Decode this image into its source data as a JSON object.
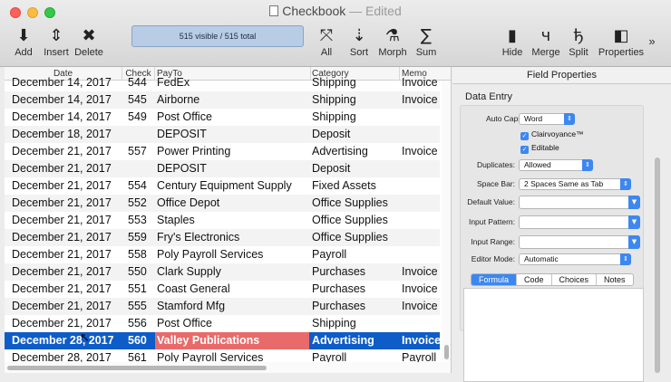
{
  "window": {
    "title": "Checkbook",
    "edited": "— Edited"
  },
  "toolbar": {
    "add": "Add",
    "insert": "Insert",
    "delete": "Delete",
    "status": "515 visible / 515 total",
    "all": "All",
    "sort": "Sort",
    "morph": "Morph",
    "sum": "Sum",
    "hide": "Hide",
    "merge": "Merge",
    "split": "Split",
    "properties": "Properties",
    "overflow": "»"
  },
  "table": {
    "columns": [
      "Date",
      "Check",
      "PayTo",
      "Category",
      "Memo"
    ],
    "rows": [
      [
        "December 14, 2017",
        "544",
        "FedEx",
        "Shipping",
        "Invoice"
      ],
      [
        "December 14, 2017",
        "545",
        "Airborne",
        "Shipping",
        "Invoice"
      ],
      [
        "December 14, 2017",
        "549",
        "Post Office",
        "Shipping",
        ""
      ],
      [
        "December 18, 2017",
        "",
        "DEPOSIT",
        "Deposit",
        ""
      ],
      [
        "December 21, 2017",
        "557",
        "Power Printing",
        "Advertising",
        "Invoice"
      ],
      [
        "December 21, 2017",
        "",
        "DEPOSIT",
        "Deposit",
        ""
      ],
      [
        "December 21, 2017",
        "554",
        "Century Equipment Supply",
        "Fixed Assets",
        ""
      ],
      [
        "December 21, 2017",
        "552",
        "Office Depot",
        "Office Supplies",
        ""
      ],
      [
        "December 21, 2017",
        "553",
        "Staples",
        "Office Supplies",
        ""
      ],
      [
        "December 21, 2017",
        "559",
        "Fry's Electronics",
        "Office Supplies",
        ""
      ],
      [
        "December 21, 2017",
        "558",
        "Poly Payroll Services",
        "Payroll",
        ""
      ],
      [
        "December 21, 2017",
        "550",
        "Clark Supply",
        "Purchases",
        "Invoice"
      ],
      [
        "December 21, 2017",
        "551",
        "Coast General",
        "Purchases",
        "Invoice"
      ],
      [
        "December 21, 2017",
        "555",
        "Stamford Mfg",
        "Purchases",
        "Invoice"
      ],
      [
        "December 21, 2017",
        "556",
        "Post Office",
        "Shipping",
        ""
      ],
      [
        "December 28, 2017",
        "560",
        "Valley Publications",
        "Advertising",
        "Invoice"
      ],
      [
        "December 28, 2017",
        "561",
        "Poly Payroll Services",
        "Payroll",
        "Payroll"
      ]
    ],
    "selected_row": 15
  },
  "panel": {
    "title": "Field Properties",
    "section": "Data Entry",
    "auto_caps_label": "Auto Caps:",
    "auto_caps_value": "Word",
    "clairvoyance": "Clairvoyance™",
    "editable": "Editable",
    "duplicates_label": "Duplicates:",
    "duplicates_value": "Allowed",
    "space_bar_label": "Space Bar:",
    "space_bar_value": "2 Spaces Same as Tab",
    "default_value_label": "Default Value:",
    "input_pattern_label": "Input Pattern:",
    "input_range_label": "Input Range:",
    "editor_mode_label": "Editor Mode:",
    "editor_mode_value": "Automatic",
    "tabs": [
      "Formula",
      "Code",
      "Choices",
      "Notes"
    ]
  },
  "colors": {
    "selection": "#0e5cc7",
    "highlight_cell": "#e96a6a",
    "control_accent": "#3d87f0",
    "status_box": "#b8cce6"
  }
}
